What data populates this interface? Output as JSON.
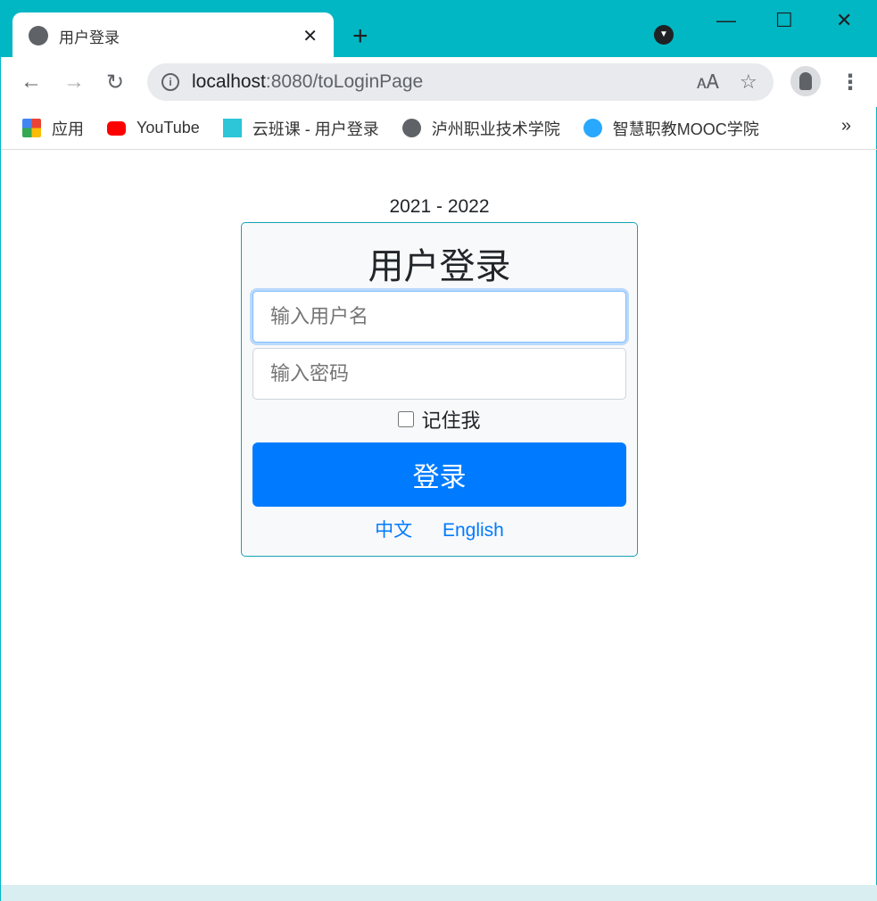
{
  "browser": {
    "tab_title": "用户登录",
    "url_host": "localhost",
    "url_rest": ":8080/toLoginPage",
    "bookmarks": [
      {
        "label": "应用",
        "icon": "apps-grid-icon"
      },
      {
        "label": "YouTube",
        "icon": "youtube-icon"
      },
      {
        "label": "云班课 - 用户登录",
        "icon": "cloud-icon"
      },
      {
        "label": "泸州职业技术学院",
        "icon": "globe-icon"
      },
      {
        "label": "智慧职教MOOC学院",
        "icon": "mooc-icon"
      }
    ],
    "more": "»"
  },
  "page": {
    "year": "2021 - 2022",
    "title": "用户登录",
    "username_placeholder": "输入用户名",
    "password_placeholder": "输入密码",
    "remember_label": "记住我",
    "remember_checked": false,
    "login_button": "登录",
    "lang_zh": "中文",
    "lang_en": "English"
  },
  "colors": {
    "accent": "#007bff",
    "titlebar": "#00b7c3",
    "card_border": "#17a2b8"
  }
}
